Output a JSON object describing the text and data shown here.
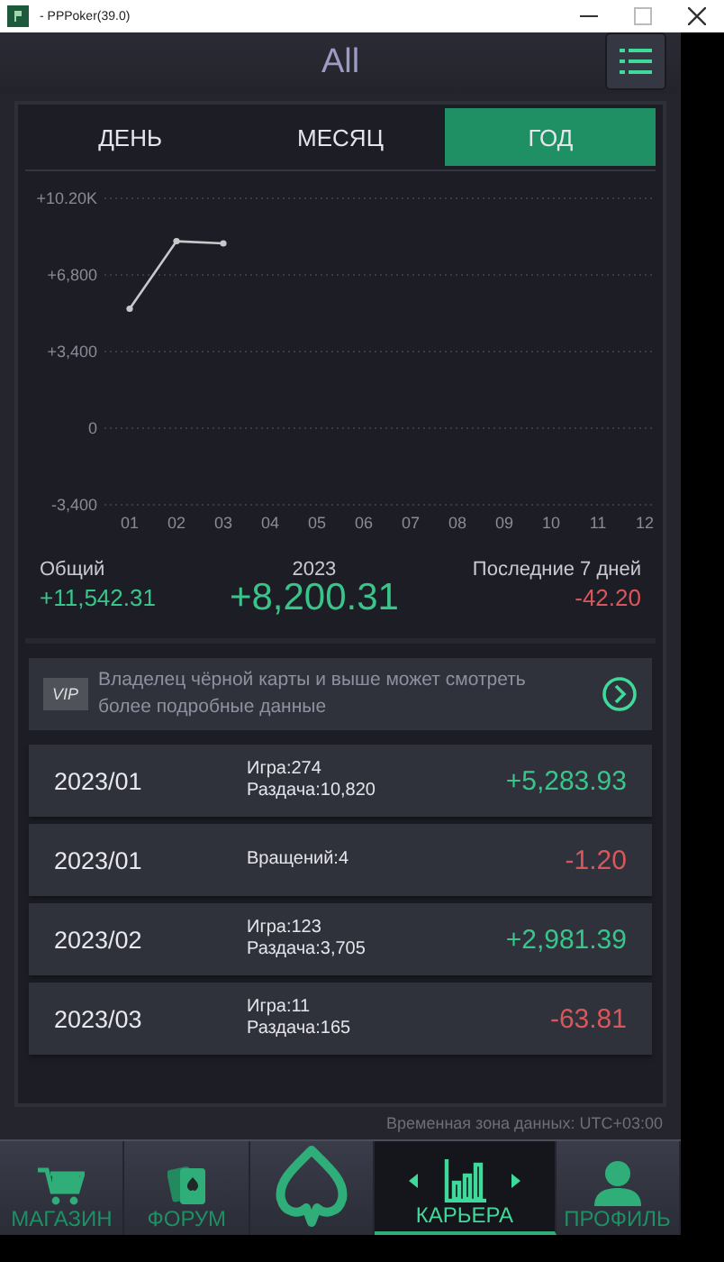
{
  "window": {
    "title": "- PPPoker(39.0)"
  },
  "header": {
    "title": "All"
  },
  "tabs": [
    {
      "label": "ДЕНЬ",
      "selected": false
    },
    {
      "label": "МЕСЯЦ",
      "selected": false
    },
    {
      "label": "ГОД",
      "selected": true
    }
  ],
  "chart_data": {
    "type": "line",
    "categories": [
      "01",
      "02",
      "03",
      "04",
      "05",
      "06",
      "07",
      "08",
      "09",
      "10",
      "11",
      "12"
    ],
    "series": [
      {
        "color": "#c8c8cc",
        "marker": true,
        "values": [
          5300,
          8300,
          8200,
          null,
          null,
          null,
          null,
          null,
          null,
          null,
          null,
          null
        ]
      }
    ],
    "grid": true,
    "ylim": [
      -3400,
      10200
    ],
    "yticks": [
      {
        "value": -3400,
        "label": "-3,400"
      },
      {
        "value": 0,
        "label": "0"
      },
      {
        "value": 3400,
        "label": "+3,400"
      },
      {
        "value": 6800,
        "label": "+6,800"
      },
      {
        "value": 10200,
        "label": "+10.20K"
      }
    ]
  },
  "summary": [
    {
      "label": "Общий",
      "value": "+11,542.31",
      "positive": true
    },
    {
      "label": "2023",
      "value": "+8,200.31",
      "positive": true
    },
    {
      "label": "Последние 7 дней",
      "value": "-42.20",
      "positive": false
    }
  ],
  "vip_banner": {
    "badge": "VIP",
    "text": "Владелец чёрной карты и выше может смотреть более подробные данные"
  },
  "rows": [
    {
      "period": "2023/01",
      "details": [
        "Игра:274",
        "Раздача:10,820"
      ],
      "amount": "+5,283.93",
      "positive": true
    },
    {
      "period": "2023/01",
      "details": [
        "Вращений:4"
      ],
      "amount": "-1.20",
      "positive": false
    },
    {
      "period": "2023/02",
      "details": [
        "Игра:123",
        "Раздача:3,705"
      ],
      "amount": "+2,981.39",
      "positive": true
    },
    {
      "period": "2023/03",
      "details": [
        "Игра:11",
        "Раздача:165"
      ],
      "amount": "-63.81",
      "positive": false
    }
  ],
  "timezone": "Временная зона данных: UTC+03:00",
  "nav": [
    {
      "kind": "cart",
      "label": "МАГАЗИН",
      "selected": false
    },
    {
      "kind": "cards",
      "label": "ФОРУМ",
      "selected": false
    },
    {
      "kind": "logo",
      "selected": false
    },
    {
      "kind": "chart",
      "label": "КАРЬЕРА",
      "selected": true
    },
    {
      "kind": "person",
      "label": "ПРОФИЛЬ",
      "selected": false
    }
  ]
}
